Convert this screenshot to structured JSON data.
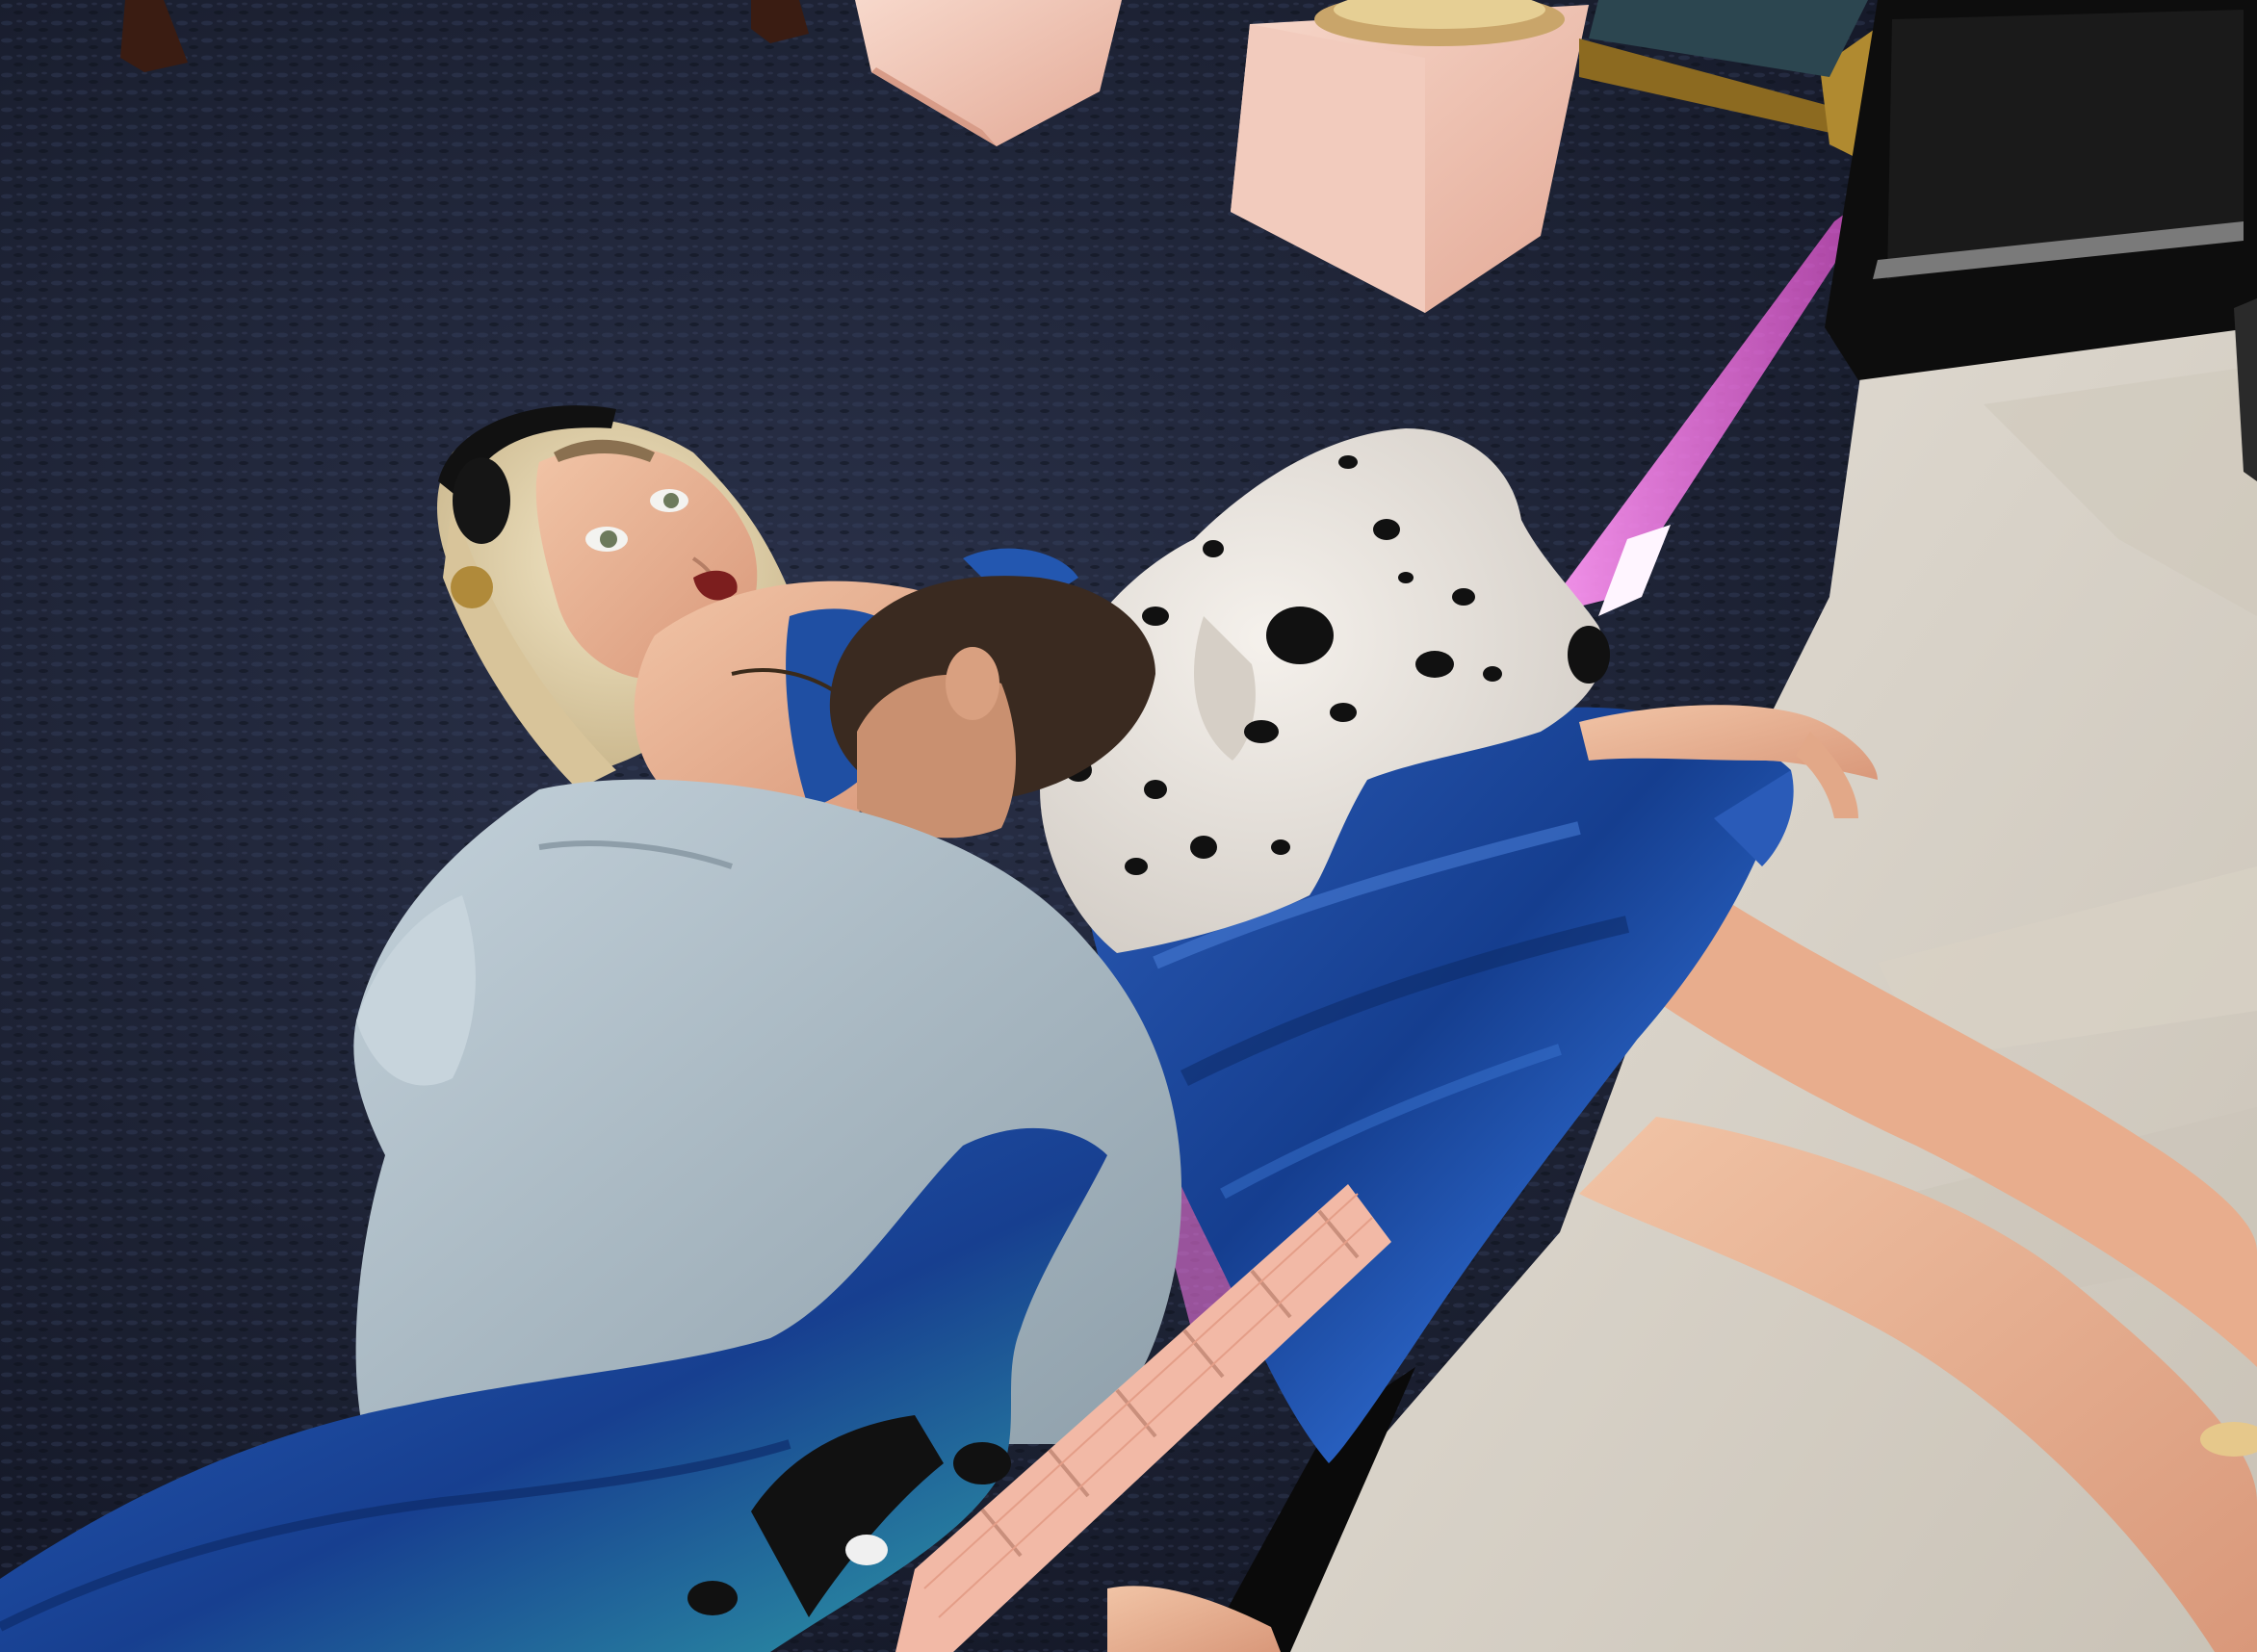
{
  "scene": {
    "kind": "3d-virtual-world-snapshot",
    "hud_text": [],
    "colors": {
      "carpet": "#1d2233",
      "carpet_highlight": "#2c3550",
      "floor": "#d9d3c8",
      "neon_strip": "#ff7cf0",
      "marble_block": "#f0c4b4",
      "picture_frame": "#8c6a20",
      "dress_blue": "#1f4fa3",
      "shirt": "#a9b9c4",
      "skin": "#e7b391",
      "hair_blonde": "#eadbb6",
      "dalmatian_white": "#ece7e2",
      "dalmatian_spot": "#111111",
      "guitar_blue": "#1d4fa6",
      "fretboard": "#f2b9a6"
    }
  }
}
